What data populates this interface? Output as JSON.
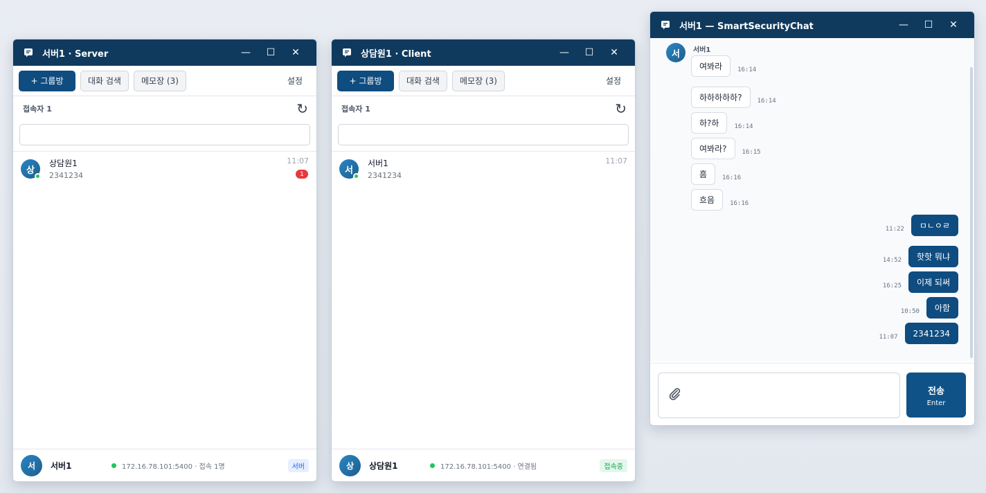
{
  "server_window": {
    "title": "서버1 · Server",
    "toolbar": {
      "group_btn": "+ 그룹방",
      "search_btn": "대화 검색",
      "memo_btn": "메모장 (3)",
      "settings": "설정"
    },
    "section_title": "접속자 1",
    "search": {
      "placeholder": "",
      "value": ""
    },
    "contacts": [
      {
        "initial": "상",
        "name": "상담원1",
        "sub": "2341234",
        "time": "11:07",
        "unread": "1"
      }
    ],
    "footer": {
      "initial": "서",
      "name": "서버1",
      "status": "172.16.78.101:5400 · 접속 1명",
      "badge": "서버"
    }
  },
  "client_window": {
    "title": "상담원1 · Client",
    "toolbar": {
      "group_btn": "+ 그룹방",
      "search_btn": "대화 검색",
      "memo_btn": "메모장 (3)",
      "settings": "설정"
    },
    "section_title": "접속자 1",
    "search": {
      "placeholder": "",
      "value": ""
    },
    "contacts": [
      {
        "initial": "서",
        "name": "서버1",
        "sub": "2341234",
        "time": "11:07"
      }
    ],
    "footer": {
      "initial": "상",
      "name": "상담원1",
      "status": "172.16.78.101:5400 · 연결됨",
      "badge": "접속중"
    }
  },
  "chat_window": {
    "title": "서버1 — SmartSecurityChat",
    "sender": {
      "initial": "서",
      "name": "서버1"
    },
    "incoming": [
      {
        "text": "여봐라",
        "time": "16:14"
      },
      {
        "text": "하하하하하?",
        "time": "16:14"
      },
      {
        "text": "하?하",
        "time": "16:14"
      },
      {
        "text": "여봐라?",
        "time": "16:15"
      },
      {
        "text": "흠",
        "time": "16:16"
      },
      {
        "text": "흐음",
        "time": "16:16"
      }
    ],
    "outgoing": [
      {
        "text": "ㅁㄴㅇㄹ",
        "time": "11:22"
      },
      {
        "text": "핫핫 뭐냐",
        "time": "14:52"
      },
      {
        "text": "이제 되써",
        "time": "16:25"
      },
      {
        "text": "아함",
        "time": "10:50"
      },
      {
        "text": "2341234",
        "time": "11:07"
      }
    ],
    "composer": {
      "placeholder": "",
      "send_label": "전송",
      "send_hint": "Enter"
    }
  },
  "colors": {
    "titlebar": "#0f3a5e",
    "primary": "#0f4c80",
    "online": "#22c55e",
    "unread": "#e5393e"
  },
  "icons": [
    "chat-icon",
    "minimize-icon",
    "maximize-icon",
    "close-icon",
    "refresh-icon",
    "paperclip-icon"
  ]
}
